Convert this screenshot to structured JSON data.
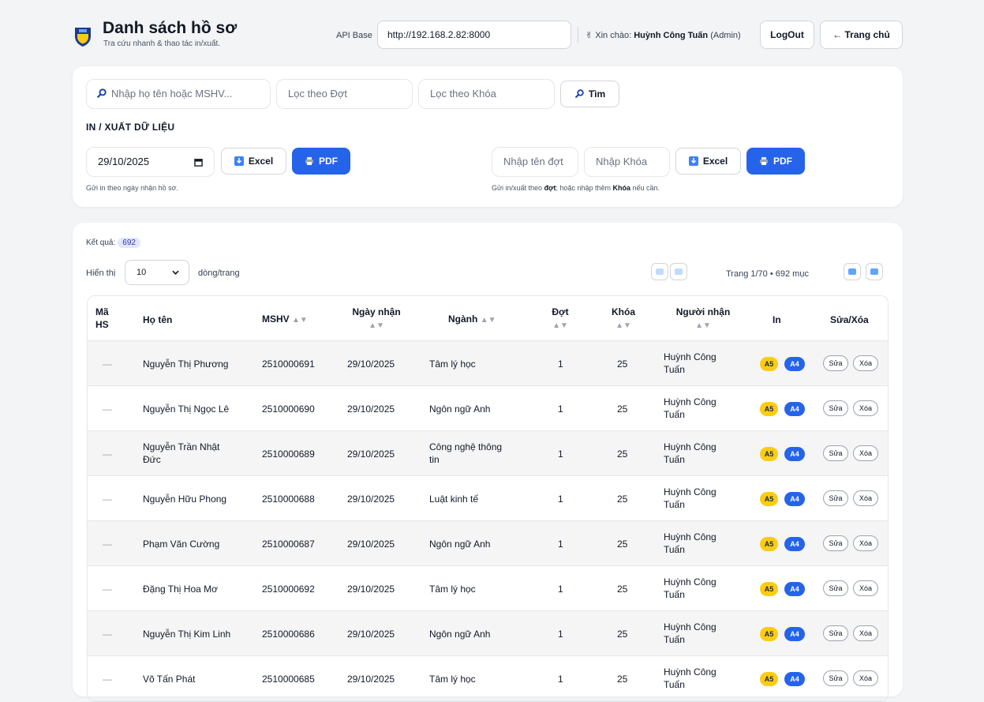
{
  "header": {
    "title": "Danh sách hồ sơ",
    "subtitle": "Tra cứu nhanh & thao tác in/xuất.",
    "api_label": "API Base",
    "api_value": "http://192.168.2.82:8000",
    "greeting_prefix": "Xin chào:",
    "user_name": "Huỳnh Công Tuấn",
    "user_role": "(Admin)",
    "logout_label": "LogOut",
    "home_label": "← Trang chủ"
  },
  "search": {
    "name_placeholder": "Nhập họ tên hoặc MSHV...",
    "batch_placeholder": "Lọc theo Đợt",
    "course_placeholder": "Lọc theo Khóa",
    "search_label": "Tìm"
  },
  "export": {
    "section_title": "IN / XUẤT DỮ LIỆU",
    "date_value": "29/10/2025",
    "excel_label": "Excel",
    "pdf_label": "PDF",
    "date_hint": "Gửi in theo ngày nhận hồ sơ.",
    "batch_placeholder": "Nhập tên đợt",
    "course_placeholder": "Nhập Khóa",
    "batch_hint_1": "Gửi in/xuất theo ",
    "batch_hint_bold1": "đợt",
    "batch_hint_2": "; hoặc nhập thêm ",
    "batch_hint_bold2": "Khóa",
    "batch_hint_3": " nếu cần."
  },
  "results": {
    "label": "Kết quả:",
    "count": "692",
    "show_label": "Hiển thị",
    "page_size": "10",
    "rows_label": "dòng/trang",
    "page_info": "Trang 1/70 • 692 mục"
  },
  "table": {
    "headers": {
      "ma_hs_1": "Mã",
      "ma_hs_2": "HS",
      "ho_ten": "Họ tên",
      "mshv": "MSHV",
      "ngay_nhan": "Ngày nhận",
      "nganh": "Ngành",
      "dot": "Đợt",
      "khoa": "Khóa",
      "nguoi_nhan": "Người nhận",
      "in": "In",
      "sua_xoa": "Sửa/Xóa",
      "sort": "▲▼"
    },
    "labels": {
      "a5": "A5",
      "a4": "A4",
      "edit": "Sửa",
      "delete": "Xóa"
    },
    "rows": [
      {
        "ma": "—",
        "name1": "Nguyễn Thị Phương",
        "name2": "",
        "mshv": "2510000691",
        "date": "29/10/2025",
        "major1": "Tâm lý học",
        "major2": "",
        "dot": "1",
        "khoa": "25",
        "rcv1": "Huỳnh Công",
        "rcv2": "Tuấn"
      },
      {
        "ma": "—",
        "name1": "Nguyễn Thị Ngọc Lê",
        "name2": "",
        "mshv": "2510000690",
        "date": "29/10/2025",
        "major1": "Ngôn ngữ Anh",
        "major2": "",
        "dot": "1",
        "khoa": "25",
        "rcv1": "Huỳnh Công",
        "rcv2": "Tuấn"
      },
      {
        "ma": "—",
        "name1": "Nguyễn Trần Nhật",
        "name2": "Đức",
        "mshv": "2510000689",
        "date": "29/10/2025",
        "major1": "Công nghệ thông",
        "major2": "tin",
        "dot": "1",
        "khoa": "25",
        "rcv1": "Huỳnh Công",
        "rcv2": "Tuấn"
      },
      {
        "ma": "—",
        "name1": "Nguyễn Hữu Phong",
        "name2": "",
        "mshv": "2510000688",
        "date": "29/10/2025",
        "major1": "Luật kinh tế",
        "major2": "",
        "dot": "1",
        "khoa": "25",
        "rcv1": "Huỳnh Công",
        "rcv2": "Tuấn"
      },
      {
        "ma": "—",
        "name1": "Phạm Văn Cường",
        "name2": "",
        "mshv": "2510000687",
        "date": "29/10/2025",
        "major1": "Ngôn ngữ Anh",
        "major2": "",
        "dot": "1",
        "khoa": "25",
        "rcv1": "Huỳnh Công",
        "rcv2": "Tuấn"
      },
      {
        "ma": "—",
        "name1": "Đặng Thị Hoa Mơ",
        "name2": "",
        "mshv": "2510000692",
        "date": "29/10/2025",
        "major1": "Tâm lý học",
        "major2": "",
        "dot": "1",
        "khoa": "25",
        "rcv1": "Huỳnh Công",
        "rcv2": "Tuấn"
      },
      {
        "ma": "—",
        "name1": "Nguyễn Thị Kim Linh",
        "name2": "",
        "mshv": "2510000686",
        "date": "29/10/2025",
        "major1": "Ngôn ngữ Anh",
        "major2": "",
        "dot": "1",
        "khoa": "25",
        "rcv1": "Huỳnh Công",
        "rcv2": "Tuấn"
      },
      {
        "ma": "—",
        "name1": "Võ Tấn Phát",
        "name2": "",
        "mshv": "2510000685",
        "date": "29/10/2025",
        "major1": "Tâm lý học",
        "major2": "",
        "dot": "1",
        "khoa": "25",
        "rcv1": "Huỳnh Công",
        "rcv2": "Tuấn"
      }
    ]
  },
  "colors": {
    "primary": "#2563eb",
    "a5_badge": "#facc15",
    "page_bg": "#f3f4f6"
  }
}
